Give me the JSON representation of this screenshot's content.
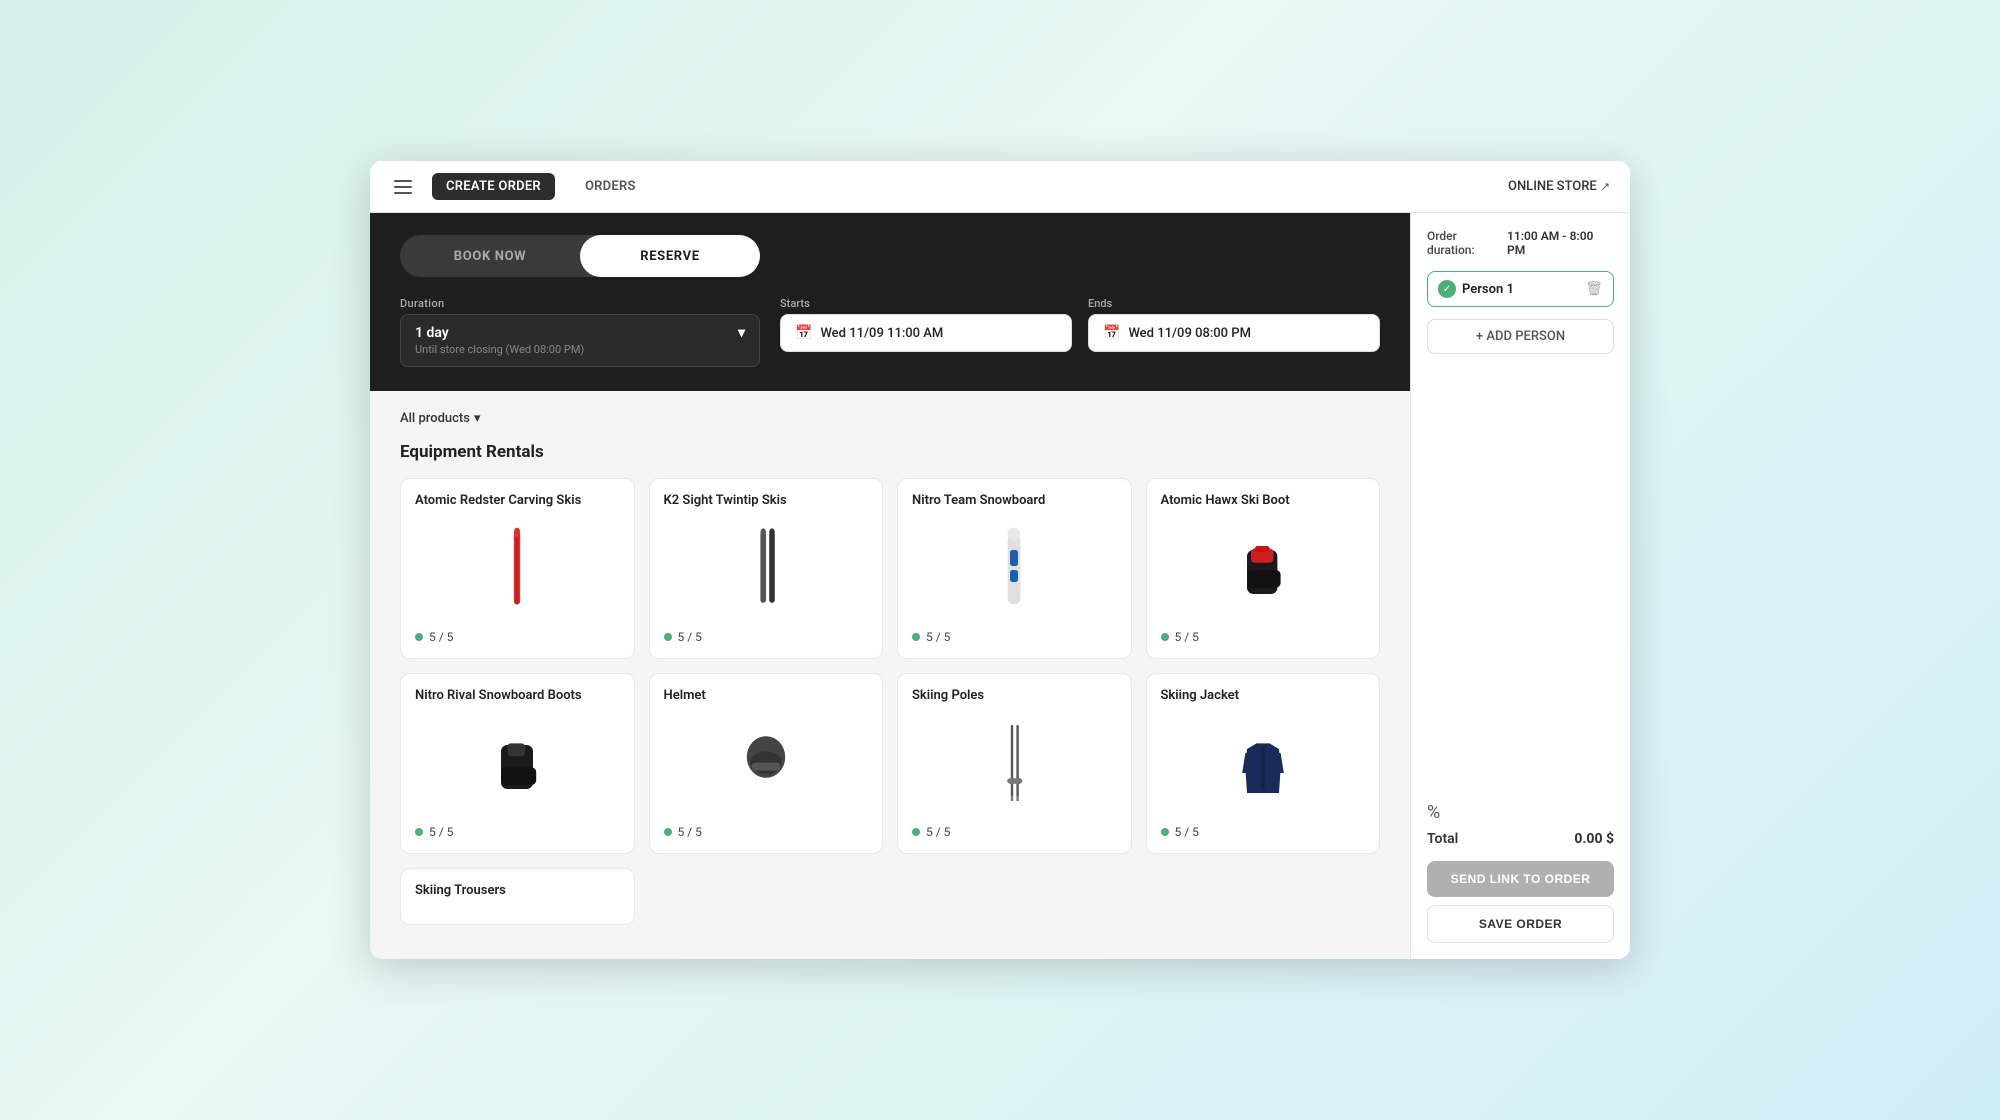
{
  "nav": {
    "hamburger_label": "menu",
    "tabs": [
      {
        "label": "CREATE ORDER",
        "active": true
      },
      {
        "label": "ORDERS",
        "active": false
      }
    ],
    "online_store_label": "ONLINE STORE",
    "external_link_icon": "↗"
  },
  "booking": {
    "modes": [
      {
        "label": "BOOK NOW",
        "active": false
      },
      {
        "label": "RESERVE",
        "active": true
      }
    ],
    "duration": {
      "label": "Duration",
      "value": "1 day",
      "subtitle": "Until store closing (Wed 08:00 PM)",
      "chevron": "▾"
    },
    "starts": {
      "label": "Starts",
      "value": "Wed 11/09 11:00 AM"
    },
    "ends": {
      "label": "Ends",
      "value": "Wed 11/09 08:00 PM"
    }
  },
  "filter": {
    "label": "All products",
    "chevron": "▾"
  },
  "section_title": "Equipment Rentals",
  "products": [
    {
      "name": "Atomic Redster Carving Skis",
      "availability": "5 / 5",
      "type": "skis"
    },
    {
      "name": "K2 Sight Twintip Skis",
      "availability": "5 / 5",
      "type": "skis2"
    },
    {
      "name": "Nitro Team Snowboard",
      "availability": "5 / 5",
      "type": "snowboard"
    },
    {
      "name": "Atomic Hawx Ski Boot",
      "availability": "5 / 5",
      "type": "boot"
    },
    {
      "name": "Nitro Rival Snowboard Boots",
      "availability": "5 / 5",
      "type": "board-boot"
    },
    {
      "name": "Helmet",
      "availability": "5 / 5",
      "type": "helmet"
    },
    {
      "name": "Skiing Poles",
      "availability": "5 / 5",
      "type": "poles"
    },
    {
      "name": "Skiing Jacket",
      "availability": "5 / 5",
      "type": "jacket"
    },
    {
      "name": "Skiing Trousers",
      "availability": "",
      "type": "pants"
    }
  ],
  "sidebar": {
    "order_duration_label": "Order duration:",
    "order_duration_value": "11:00 AM - 8:00 PM",
    "person": {
      "name": "Person 1",
      "check_icon": "✓"
    },
    "add_person_label": "+ ADD PERSON",
    "discount_icon": "%",
    "total_label": "Total",
    "total_value": "0.00 $",
    "send_link_label": "SEND LINK TO ORDER",
    "save_order_label": "SAVE ORDER"
  }
}
